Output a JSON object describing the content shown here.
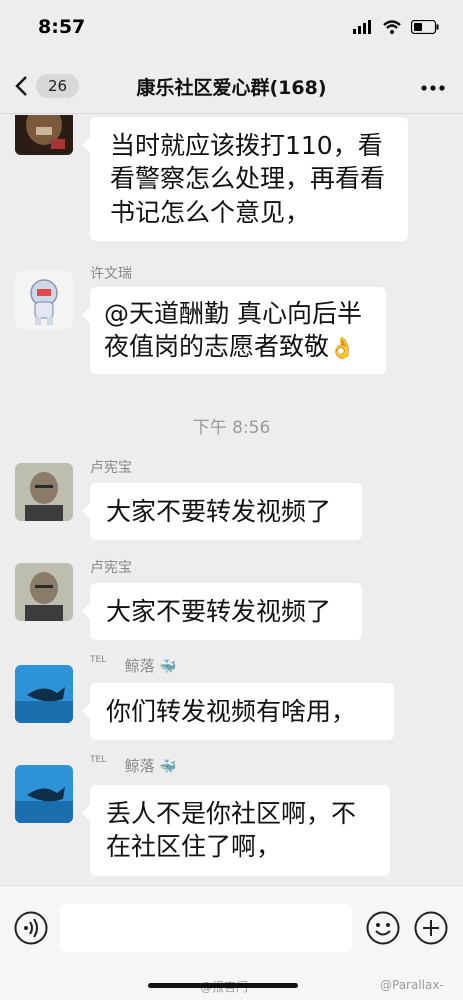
{
  "status_bar": {
    "time": "8:57"
  },
  "nav": {
    "unread_count": "26",
    "title": "康乐社区爱心群(168)"
  },
  "messages": [
    {
      "sender": "",
      "text": "当时就应该拨打110，看看警察怎么处理，再看看书记怎么个意见，",
      "avatar": "cat-avatar"
    },
    {
      "sender": "许文瑞",
      "text": "@天道酬勤 真心向后半夜值岗的志愿者致敬",
      "emoji": "👌",
      "avatar": "astronaut-avatar"
    },
    {
      "time_separator": "下午 8:56"
    },
    {
      "sender": "卢宪宝",
      "text": "大家不要转发视频了",
      "avatar": "portrait-avatar"
    },
    {
      "sender": "卢宪宝",
      "text": "大家不要转发视频了",
      "avatar": "portrait-avatar"
    },
    {
      "sender": "鲸落",
      "sender_prefix": "TEL",
      "sender_emoji": "🐳",
      "text": "你们转发视频有啥用，",
      "avatar": "whale-avatar"
    },
    {
      "sender": "鲸落",
      "sender_prefix": "TEL",
      "sender_emoji": "🐳",
      "text": "丢人不是你社区啊，不在社区住了啊，",
      "avatar": "whale-avatar"
    }
  ],
  "watermarks": {
    "bottom_center": "@报官门",
    "bottom_right": "@Parallax-"
  },
  "colors": {
    "background": "#ededed",
    "bubble": "#ffffff",
    "sender": "#8a8a8a",
    "whale_blue": "#2d93d6"
  }
}
